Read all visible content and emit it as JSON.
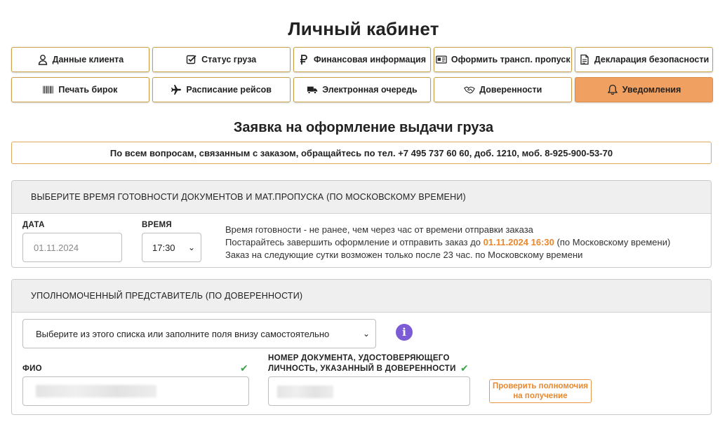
{
  "page": {
    "title": "Личный кабинет",
    "subtitle": "Заявка на оформление выдачи груза"
  },
  "nav": {
    "row1": [
      {
        "label": "Данные клиента",
        "icon": "user-icon"
      },
      {
        "label": "Статус груза",
        "icon": "checkbox-icon"
      },
      {
        "label": "Финансовая информация",
        "icon": "ruble-icon"
      },
      {
        "label": "Оформить трансп. пропуск",
        "icon": "id-card-icon"
      },
      {
        "label": "Декларация безопасности",
        "icon": "document-icon"
      }
    ],
    "row2": [
      {
        "label": "Печать бирок",
        "icon": "barcode-icon"
      },
      {
        "label": "Расписание рейсов",
        "icon": "plane-icon"
      },
      {
        "label": "Электронная очередь",
        "icon": "truck-icon"
      },
      {
        "label": "Доверенности",
        "icon": "handshake-icon"
      },
      {
        "label": "Уведомления",
        "icon": "bell-icon",
        "active": true
      }
    ]
  },
  "contact": {
    "text": "По всем вопросам, связанным с заказом, обращайтесь по тел. +7 495 737 60 60, доб. 1210, моб. 8-925-900-53-70"
  },
  "time_panel": {
    "header": "ВЫБЕРИТЕ ВРЕМЯ ГОТОВНОСТИ ДОКУМЕНТОВ И МАТ.ПРОПУСКА (ПО МОСКОВСКОМУ ВРЕМЕНИ)",
    "date_label": "ДАТА",
    "date_value": "01.11.2024",
    "time_label": "ВРЕМЯ",
    "time_value": "17:30",
    "info_line1": "Время готовности - не ранее, чем через час от времени отправки заказа",
    "info_line2_prefix": "Постарайтесь завершить оформление и отправить заказ до ",
    "info_line2_highlight": "01.11.2024 16:30",
    "info_line2_suffix": " (по Московскому времени)",
    "info_line3": "Заказ на следующие сутки возможен только после 23 час. по Московскому времени"
  },
  "rep_panel": {
    "header": "УПОЛНОМОЧЕННЫЙ ПРЕДСТАВИТЕЛЬ (ПО ДОВЕРЕННОСТИ)",
    "select_value": "Выберите из этого списка или заполните поля внизу самостоятельно",
    "fio_label": "ФИО",
    "doc_label_line1": "НОМЕР ДОКУМЕНТА, УДОСТОВЕРЯЮЩЕГО",
    "doc_label_line2": "ЛИЧНОСТЬ, УКАЗАННЫЙ В ДОВЕРЕННОСТИ",
    "verify_line1": "Проверить полномочия",
    "verify_line2": "на получение"
  },
  "colors": {
    "accent": "#f0a060",
    "highlight": "#e8882f",
    "border_gold": "#c7a046",
    "check_green": "#3fa34d",
    "info_purple": "#7b5cd6"
  }
}
